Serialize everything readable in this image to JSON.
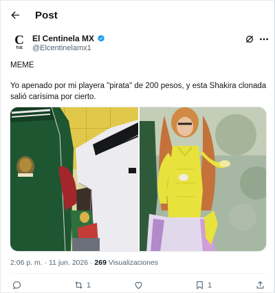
{
  "header": {
    "title": "Post"
  },
  "account": {
    "display_name": "El Centinela MX",
    "handle": "@Elcentinelamx1",
    "avatar_letter": "C",
    "avatar_sub": "TUE",
    "verified_color": "#1d9bf0"
  },
  "tweet": {
    "line1": "MEME",
    "line2": "Yo apenado por mi playera \"pirata\" de 200 pesos, y esta Shakira clonada salió carísima por cierto."
  },
  "meta": {
    "time": "2:06 p. m.",
    "separator": "·",
    "date": "11 jun. 2026",
    "views_count": "269",
    "views_label": "Visualizaciones"
  },
  "actions": {
    "reply_count": "",
    "retweet_count": "1",
    "like_count": "",
    "bookmark_count": "1"
  },
  "icons": [
    "back-arrow-icon",
    "verified-badge-icon",
    "grok-icon",
    "more-icon",
    "reply-icon",
    "retweet-icon",
    "like-icon",
    "bookmark-icon",
    "share-icon"
  ],
  "colors": {
    "text": "#0f1419",
    "secondary": "#536471",
    "accent": "#1d9bf0",
    "jersey_green": "#1f5a35",
    "yellow_outfit": "#e8e23c"
  }
}
